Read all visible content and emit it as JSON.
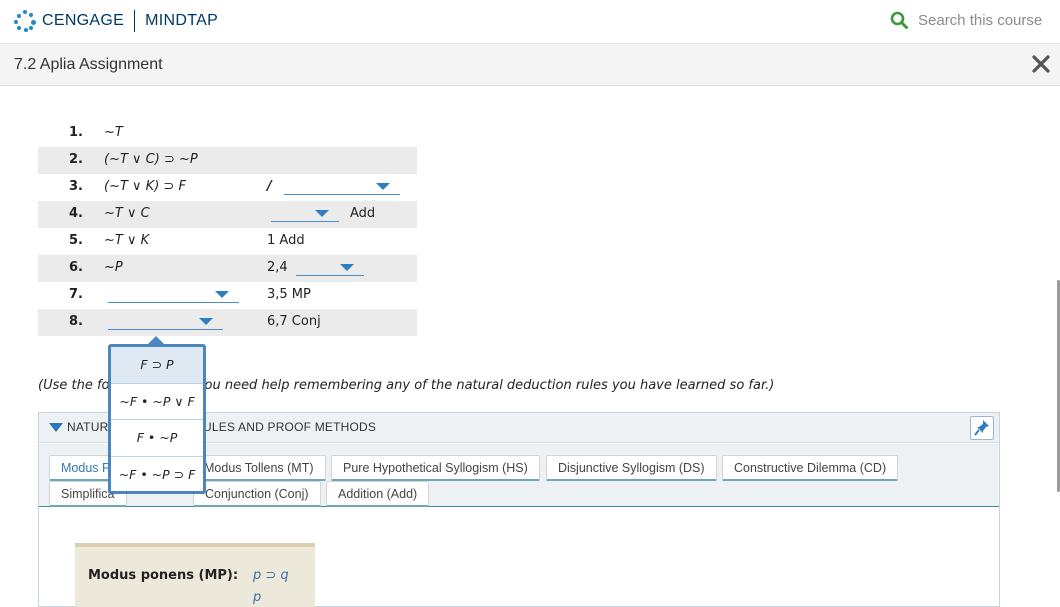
{
  "header": {
    "brand_left": "CENGAGE",
    "brand_right": "MINDTAP",
    "search_placeholder": "Search this course"
  },
  "assignment": {
    "title": "7.2 Aplia Assignment"
  },
  "proof": {
    "rows": [
      {
        "num": "1.",
        "formula": "~T",
        "just": ""
      },
      {
        "num": "2.",
        "formula": "(~T ∨ C) ⊃ ~P",
        "just": ""
      },
      {
        "num": "3.",
        "formula": "(~T ∨ K) ⊃ F",
        "just": "/"
      },
      {
        "num": "4.",
        "formula": "~T ∨ C",
        "just": "Add"
      },
      {
        "num": "5.",
        "formula": "~T ∨ K",
        "just": "1 Add"
      },
      {
        "num": "6.",
        "formula": "~P",
        "just": "2,4"
      },
      {
        "num": "7.",
        "formula": "",
        "just": "3,5 MP"
      },
      {
        "num": "8.",
        "formula": "",
        "just": "6,7 Conj"
      }
    ]
  },
  "dropdown_options": [
    "F ⊃ P",
    "~F • ~P ∨ F",
    "F • ~P",
    "~F • ~P ⊃ F"
  ],
  "hint": {
    "before": "(Use the fo",
    "after": "ou need help remembering any of the natural deduction rules you have learned so far.)"
  },
  "rules_panel": {
    "title_left": "NATURA",
    "title_right": "ULES AND PROOF METHODS",
    "tabs": [
      "Modus P",
      "Modus Tollens (MT)",
      "Pure Hypothetical Syllogism (HS)",
      "Disjunctive Syllogism (DS)",
      "Constructive Dilemma (CD)",
      "Simplifica",
      "Conjunction (Conj)",
      "Addition (Add)"
    ],
    "mp_label": "Modus ponens (MP):",
    "mp_line1": "p ⊃ q",
    "mp_line2": "p"
  },
  "colors": {
    "brand": "#003865",
    "accent": "#2d7fc1",
    "search_icon": "#3a9a3a"
  }
}
